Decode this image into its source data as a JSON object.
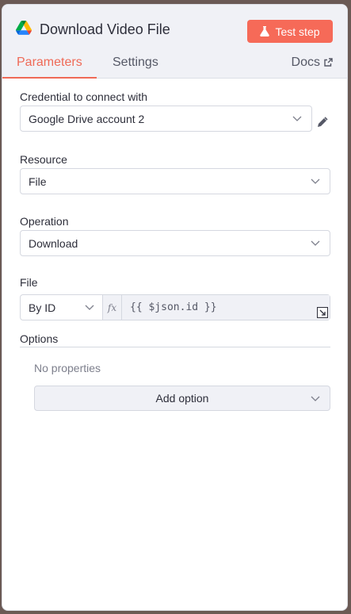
{
  "header": {
    "title": "Download Video File",
    "test_step_label": "Test step",
    "app_icon": "google-drive-icon"
  },
  "tabs": [
    {
      "label": "Parameters",
      "active": true
    },
    {
      "label": "Settings",
      "active": false
    },
    {
      "label": "Docs",
      "active": false
    }
  ],
  "fields": {
    "credential": {
      "label": "Credential to connect with",
      "value": "Google Drive account 2"
    },
    "resource": {
      "label": "Resource",
      "value": "File"
    },
    "operation": {
      "label": "Operation",
      "value": "Download"
    },
    "file": {
      "label": "File",
      "mode": "By ID",
      "fx": "fx",
      "expression": "{{ $json.id }}"
    }
  },
  "options": {
    "label": "Options",
    "empty_text": "No properties",
    "add_label": "Add option"
  },
  "colors": {
    "accent": "#ef6a57",
    "button": "#f66a58"
  }
}
